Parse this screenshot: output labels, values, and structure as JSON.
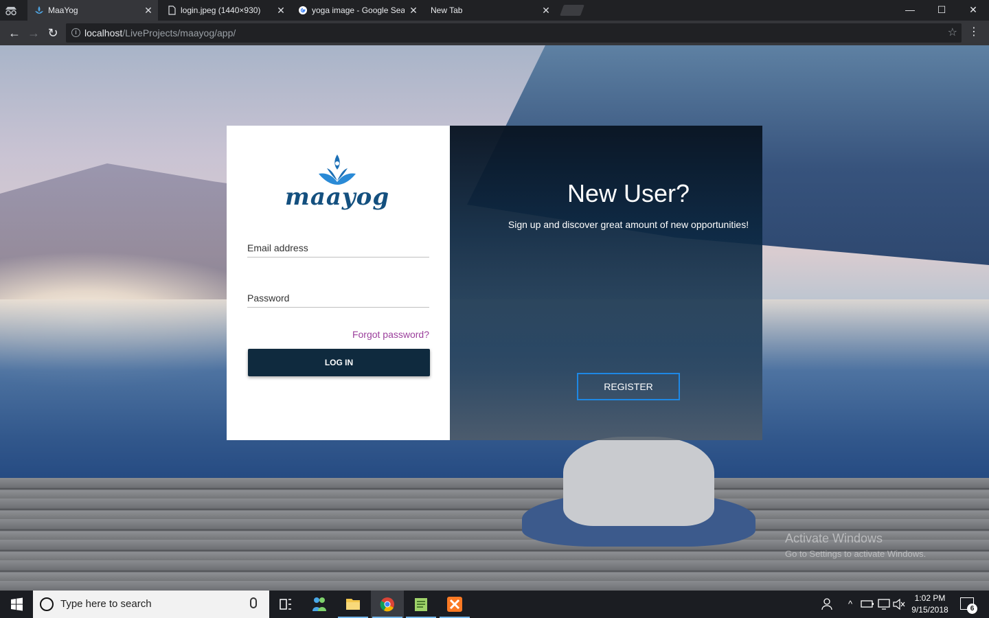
{
  "browser": {
    "tabs": [
      {
        "title": "MaaYog",
        "active": true
      },
      {
        "title": "login.jpeg (1440×930)",
        "active": false
      },
      {
        "title": "yoga image - Google Sea",
        "active": false
      },
      {
        "title": "New Tab",
        "active": false
      }
    ],
    "url_host": "localhost",
    "url_path": "/LiveProjects/maayog/app/",
    "window_controls": {
      "minimize": "—",
      "maximize": "☐",
      "close": "✕"
    }
  },
  "login": {
    "logo_text": "maayog",
    "email_placeholder": "Email address",
    "password_placeholder": "Password",
    "forgot_label": "Forgot password?",
    "login_button": "LOG IN"
  },
  "register": {
    "title": "New User?",
    "subtitle": "Sign up and discover great amount of new opportunities!",
    "button": "REGISTER"
  },
  "watermark": {
    "line1": "Activate Windows",
    "line2": "Go to Settings to activate Windows."
  },
  "taskbar": {
    "search_placeholder": "Type here to search",
    "time": "1:02 PM",
    "date": "9/15/2018",
    "notification_count": "6"
  },
  "colors": {
    "login_button": "#0f2a3e",
    "forgot_link": "#9b3f9c",
    "register_border": "#1e88e5",
    "logo": "#14507f"
  }
}
